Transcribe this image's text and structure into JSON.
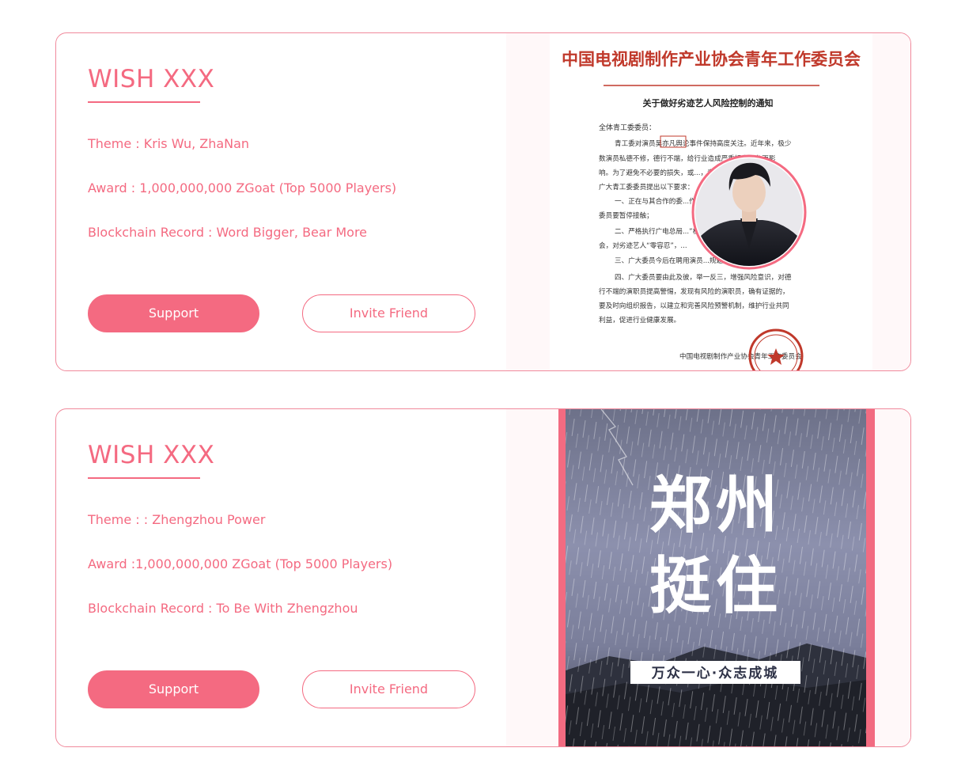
{
  "cards": [
    {
      "title": "WISH XXX",
      "theme": "Theme : Kris Wu, ZhaNan",
      "award": "Award : 1,000,000,000 ZGoat (Top 5000 Players)",
      "blockchain_record": "Blockchain Record : Word Bigger, Bear More",
      "support_label": "Support",
      "invite_label": "Invite Friend",
      "image": {
        "kind": "notice-document",
        "heading": "中国电视剧制作产业协会青年工作委员会",
        "subheading": "关于做好劣迹艺人风险控制的通知",
        "salutation": "全体青工委委员：",
        "body_lines": [
          "青工委对演员吴亦凡舆论事件保持高度关注。近年来，极少",
          "数演员私德不修，德行不端，给行业造成严重损失和负面影",
          "响。为了避免不必要的损失，或...，青工委对",
          "广大青工委委员提出以下要求：",
          "一、正在与其合作的委...作的",
          "委员要暂停接触；",
          "二、严格执行广电总局...”机",
          "会，对劣迹艺人“零容忍”，...",
          "三、广大委员今后在聘用演员...规避风险；",
          "四、广大委员要由此及彼，举一反三，增强风险意识，对德",
          "行不端的演职员提高警惕，发现有风险的演职员，确有证据的，",
          "要及时向组织报告，以建立和完善风险预警机制，维护行业共同",
          "利益，促进行业健康发展。"
        ],
        "signature": "中国电视剧制作产业协会青年工作委员会"
      }
    },
    {
      "title": "WISH XXX",
      "theme": "Theme : : Zhengzhou Power",
      "award": "Award :1,000,000,000 ZGoat (Top 5000 Players)",
      "blockchain_record": "Blockchain Record : To Be With Zhengzhou",
      "support_label": "Support",
      "invite_label": "Invite Friend",
      "image": {
        "kind": "rainstorm-poster",
        "calligraphy_line1": "郑州",
        "calligraphy_line2": "挺住",
        "banner": "万众一心·众志成城"
      }
    }
  ],
  "colors": {
    "accent": "#f46a81",
    "border": "#f08a9c",
    "document_red": "#c0392b",
    "poster_frame": "#f26b81"
  }
}
